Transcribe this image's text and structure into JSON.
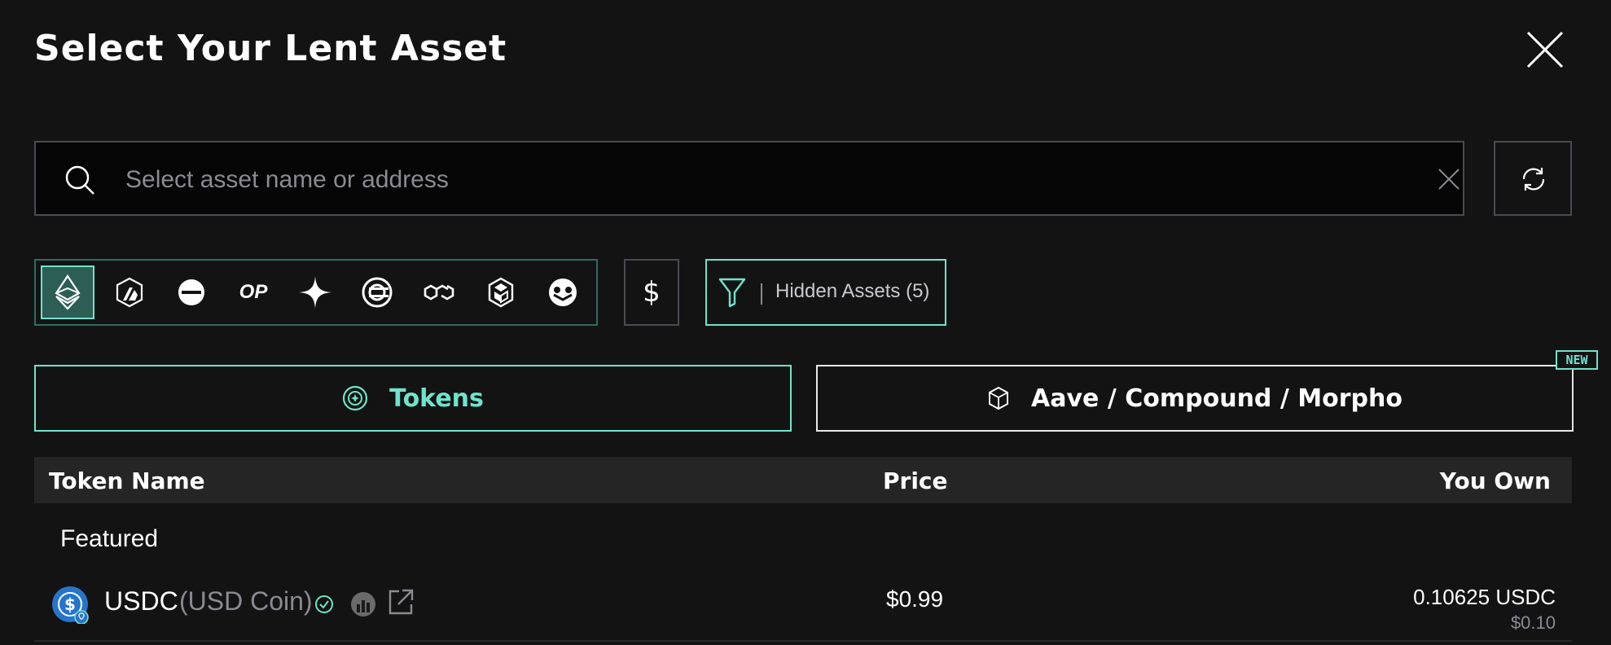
{
  "title": "Select Your Lent Asset",
  "search": {
    "placeholder": "Select asset name or address",
    "value": ""
  },
  "chains": [
    {
      "name": "ethereum",
      "icon": "ethereum-icon",
      "active": true
    },
    {
      "name": "arbitrum",
      "icon": "arbitrum-icon",
      "active": false
    },
    {
      "name": "base",
      "icon": "base-icon",
      "active": false
    },
    {
      "name": "optimism",
      "icon": "optimism-icon",
      "label": "OP",
      "active": false
    },
    {
      "name": "sparkle",
      "icon": "sparkle-icon",
      "active": false
    },
    {
      "name": "celo",
      "icon": "celo-icon",
      "active": false
    },
    {
      "name": "polygon",
      "icon": "polygon-icon",
      "active": false
    },
    {
      "name": "bnb",
      "icon": "bnb-icon",
      "active": false
    },
    {
      "name": "gnosis",
      "icon": "gnosis-icon",
      "active": false
    }
  ],
  "dollar_filter_label": "$",
  "hidden_assets_label": "Hidden Assets (5)",
  "tabs": {
    "tokens": "Tokens",
    "aave": "Aave / Compound / Morpho",
    "new_badge": "NEW"
  },
  "table": {
    "headers": {
      "token_name": "Token Name",
      "price": "Price",
      "you_own": "You Own"
    },
    "section": "Featured",
    "rows": [
      {
        "symbol": "USDC",
        "name": "(USD Coin)",
        "price": "$0.99",
        "amount": "0.10625 USDC",
        "usd_value": "$0.10"
      }
    ]
  },
  "colors": {
    "background": "#131313",
    "accent": "#6fe3cb",
    "usdc_blue": "#2775ca",
    "muted": "#8a8a92"
  }
}
